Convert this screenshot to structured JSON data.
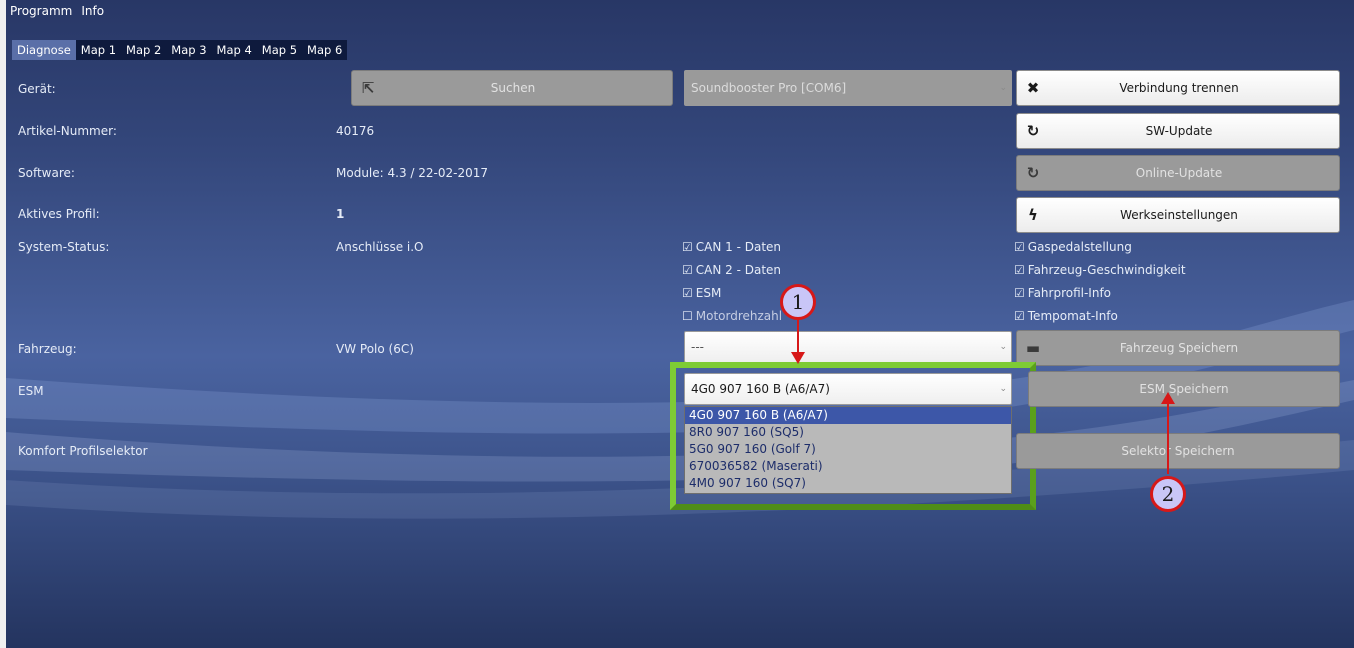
{
  "menu": [
    "Programm",
    "Info"
  ],
  "tabs": [
    "Diagnose",
    "Map 1",
    "Map 2",
    "Map 3",
    "Map 4",
    "Map 5",
    "Map 6"
  ],
  "active_tab": "Diagnose",
  "rows": {
    "geraet_label": "Gerät:",
    "artikel_label": "Artikel-Nummer:",
    "artikel_value": "40176",
    "software_label": "Software:",
    "software_value": "Module: 4.3 / 22-02-2017",
    "profil_label": "Aktives Profil:",
    "profil_value": "1",
    "status_label": "System-Status:",
    "status_value": "Anschlüsse i.O",
    "fahrzeug_label": "Fahrzeug:",
    "fahrzeug_value": "VW Polo (6C)",
    "esm_label": "ESM",
    "komfort_label": "Komfort Profilselektor"
  },
  "buttons": {
    "suchen": "Suchen",
    "verbindung": "Verbindung trennen",
    "sw_update": "SW-Update",
    "online_update": "Online-Update",
    "werk": "Werkseinstellungen",
    "fahrzeug_save": "Fahrzeug Speichern",
    "esm_save": "ESM Speichern",
    "selektor_save": "Selektor Speichern"
  },
  "device_select": "Soundbooster Pro [COM6]",
  "vehicle_select": "---",
  "esm_select": "4G0 907 160 B (A6/A7)",
  "esm_options": [
    "4G0 907 160 B (A6/A7)",
    "8R0 907 160 (SQ5)",
    "5G0 907 160 (Golf 7)",
    "670036582 (Maserati)",
    "4M0 907 160 (SQ7)"
  ],
  "checks_left": [
    {
      "label": "CAN 1 - Daten",
      "checked": true
    },
    {
      "label": "CAN 2 - Daten",
      "checked": true
    },
    {
      "label": "ESM",
      "checked": true
    },
    {
      "label": "Motordrehzahl",
      "checked": false
    }
  ],
  "checks_right": [
    {
      "label": "Gaspedalstellung",
      "checked": true
    },
    {
      "label": "Fahrzeug-Geschwindigkeit",
      "checked": true
    },
    {
      "label": "Fahrprofil-Info",
      "checked": true
    },
    {
      "label": "Tempomat-Info",
      "checked": true
    }
  ],
  "callouts": [
    "1",
    "2"
  ],
  "colors": {
    "highlight": "#7ecb35",
    "callout_border": "#d71818",
    "callout_fill": "#c9c6f7",
    "selected_option": "#3d57a8"
  }
}
